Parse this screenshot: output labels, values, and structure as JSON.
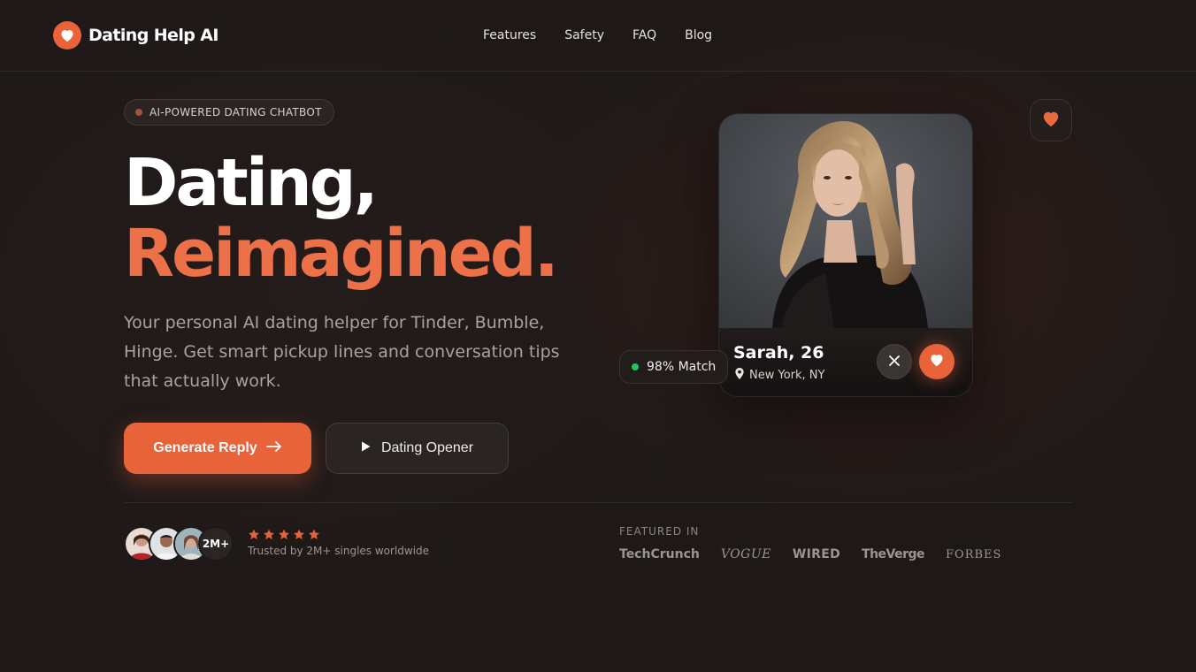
{
  "brand": {
    "name": "Dating Help AI",
    "icon": "heart-icon",
    "accent": "#e8623a"
  },
  "nav": {
    "items": [
      {
        "label": "Features"
      },
      {
        "label": "Safety"
      },
      {
        "label": "FAQ"
      },
      {
        "label": "Blog"
      }
    ]
  },
  "hero": {
    "badge": "AI-POWERED DATING CHATBOT",
    "title_line1": "Dating,",
    "title_line2": "Reimagined.",
    "lead": "Your personal AI dating helper for Tinder, Bumble, Hinge. Get smart pickup lines and conversation tips that actually work.",
    "primary_cta": "Generate Reply",
    "secondary_cta": "Dating Opener"
  },
  "social_proof": {
    "count_badge": "2M+",
    "rating_stars": 5,
    "trusted_text": "Trusted by 2M+ singles worldwide"
  },
  "featured": {
    "label": "FEATURED IN",
    "brands": [
      "TechCrunch",
      "VOGUE",
      "WIRED",
      "TheVerge",
      "FORBES"
    ]
  },
  "profile_card": {
    "name": "Sarah, 26",
    "location": "New York, NY",
    "match": "98% Match",
    "match_color": "#22c55e"
  }
}
